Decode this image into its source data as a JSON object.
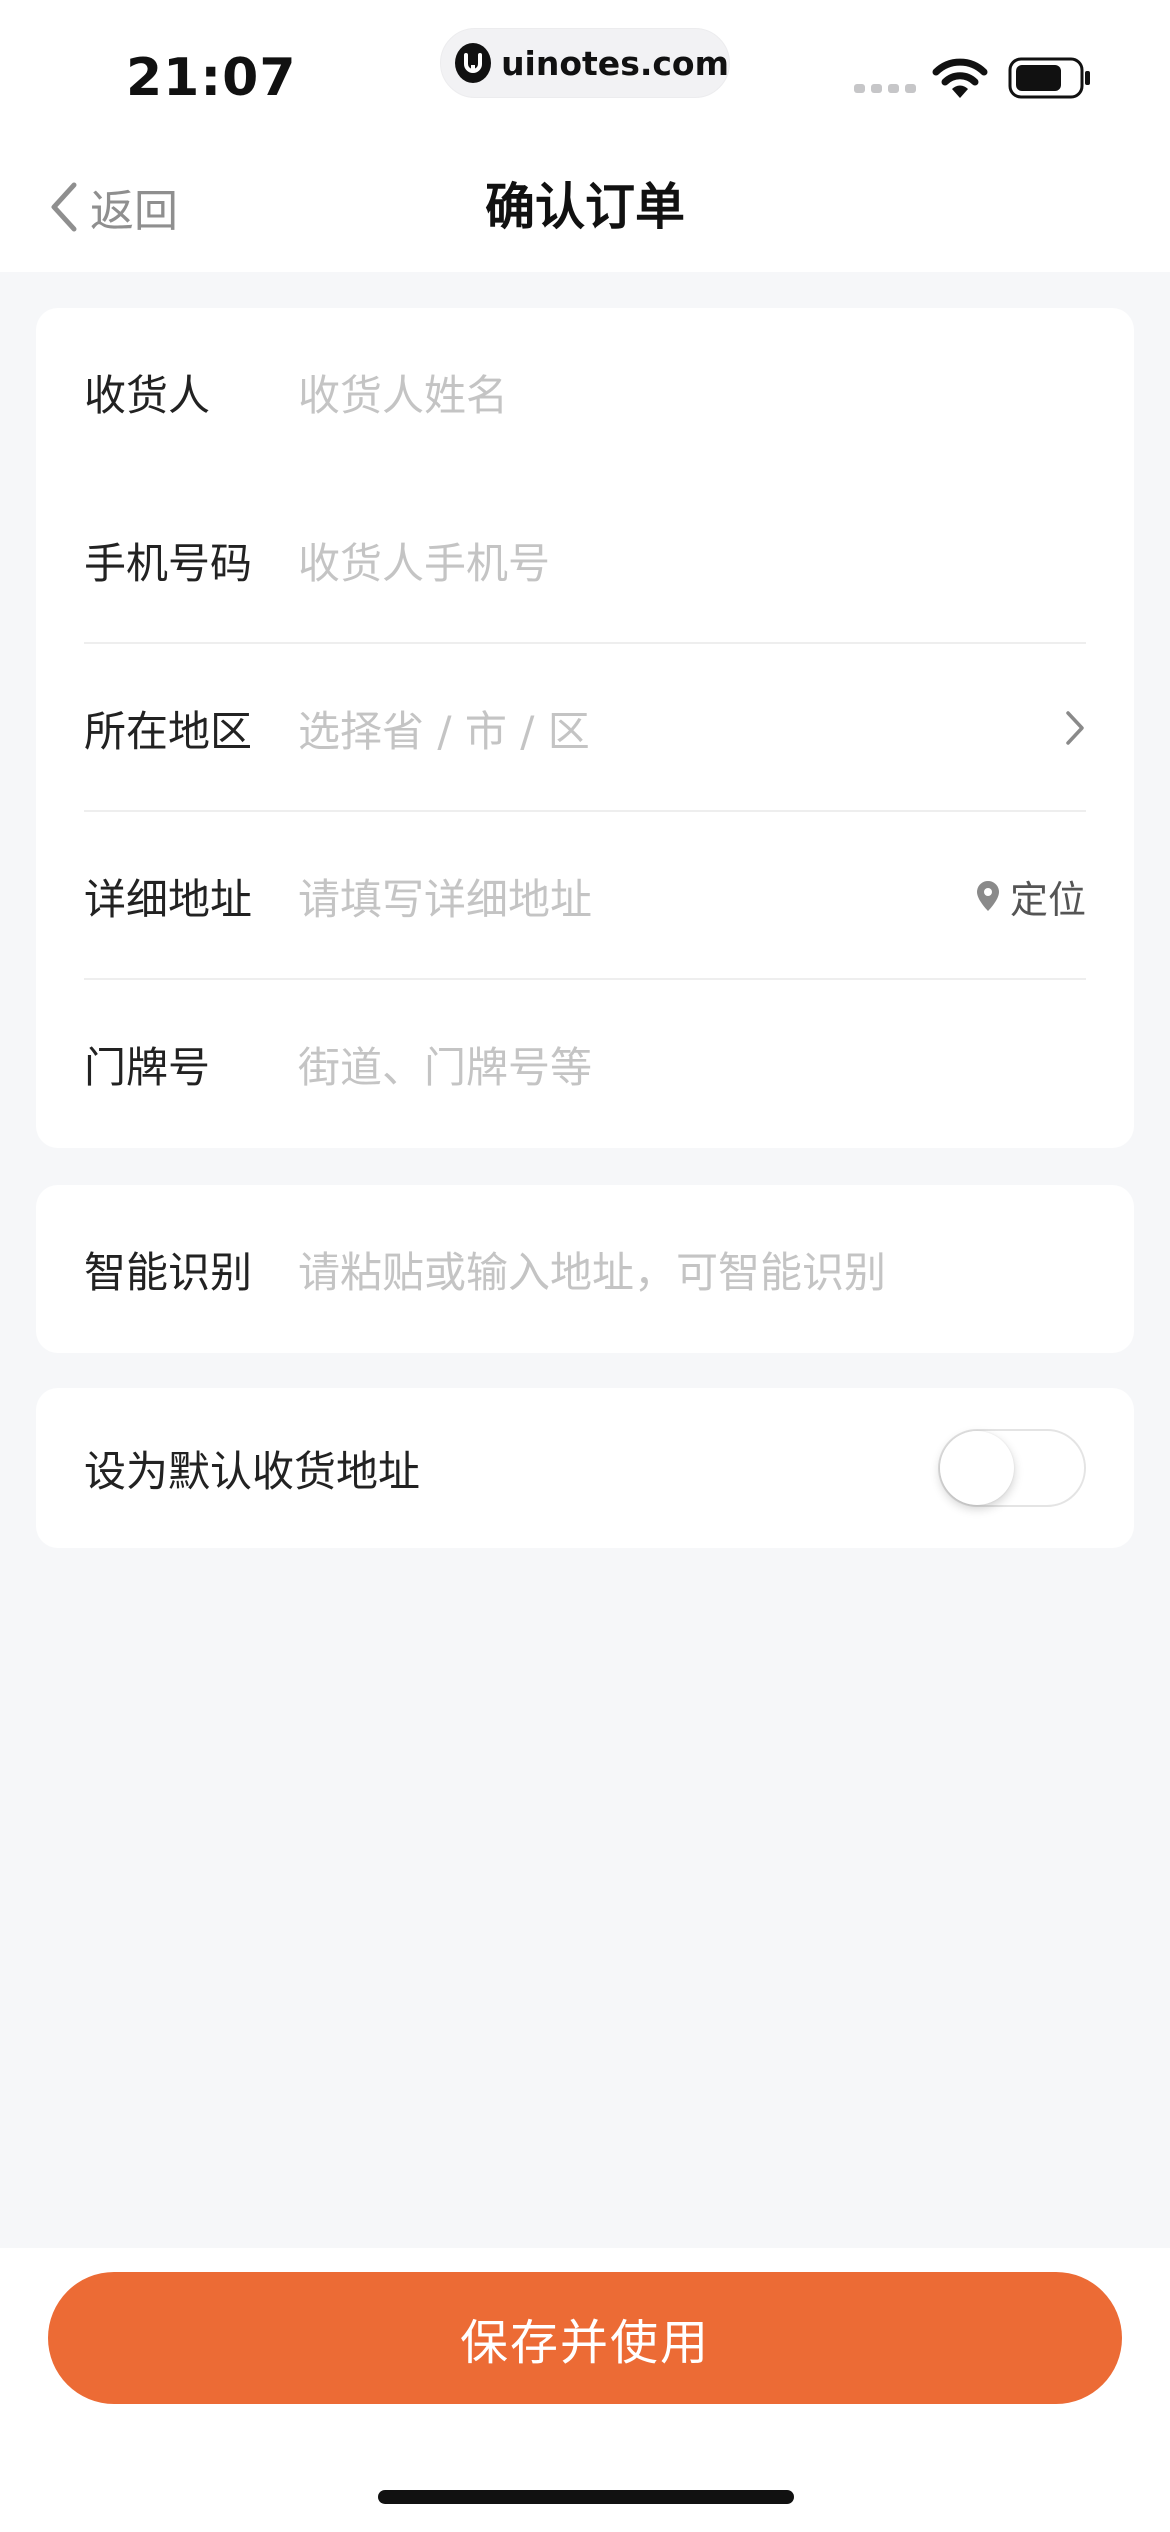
{
  "status_bar": {
    "time": "21:07",
    "url": "uinotes.com",
    "icons": [
      "signal-icon",
      "wifi-icon",
      "battery-icon"
    ]
  },
  "nav": {
    "back_label": "返回",
    "title": "确认订单"
  },
  "address_form": {
    "recipient": {
      "label": "收货人",
      "placeholder": "收货人姓名"
    },
    "phone": {
      "label": "手机号码",
      "placeholder": "收货人手机号"
    },
    "region": {
      "label": "所在地区",
      "placeholder": "选择省 / 市 / 区"
    },
    "detail": {
      "label": "详细地址",
      "placeholder": "请填写详细地址",
      "locate_label": "定位"
    },
    "house_number": {
      "label": "门牌号",
      "placeholder": "街道、门牌号等"
    }
  },
  "smart_recognition": {
    "label": "智能识别",
    "placeholder": "请粘贴或输入地址，可智能识别"
  },
  "default_address": {
    "label": "设为默认收货地址",
    "enabled": false
  },
  "save_button": {
    "label": "保存并使用"
  },
  "colors": {
    "accent": "#ec6b35",
    "background": "#f6f7f9",
    "placeholder": "#c4c4c4",
    "label": "#222222"
  }
}
